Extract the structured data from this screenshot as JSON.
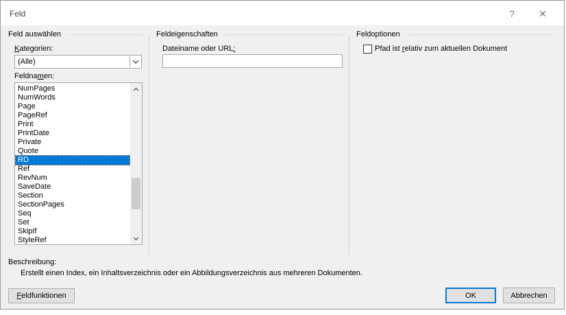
{
  "window": {
    "title": "Feld",
    "help_label": "?",
    "close_label": "✕"
  },
  "field_select": {
    "title": "Feld auswählen",
    "categories_label_first": "K",
    "categories_label_rest": "ategorien:",
    "categories_value": "(Alle)",
    "fieldnames_label_pre": "Feldna",
    "fieldnames_label_u": "m",
    "fieldnames_label_post": "en:",
    "items": [
      "NumPages",
      "NumWords",
      "Page",
      "PageRef",
      "Print",
      "PrintDate",
      "Private",
      "Quote",
      "RD",
      "Ref",
      "RevNum",
      "SaveDate",
      "Section",
      "SectionPages",
      "Seq",
      "Set",
      "SkipIf",
      "StyleRef"
    ],
    "selected": "RD"
  },
  "properties": {
    "title": "Feldeigenschaften",
    "filename_label_pre": "Dateiname oder URL",
    "filename_label_u": ":",
    "filename_value": ""
  },
  "options": {
    "title": "Feldoptionen",
    "checkbox_pre": "Pfad ist ",
    "checkbox_u": "r",
    "checkbox_post": "elativ zum aktuellen Dokument",
    "checked": false
  },
  "description": {
    "label": "Beschreibung:",
    "text": "Erstellt einen Index, ein Inhaltsverzeichnis oder ein Abbildungsverzeichnis aus mehreren Dokumenten."
  },
  "buttons": {
    "field_codes_u": "F",
    "field_codes_rest": "eldfunktionen",
    "ok": "OK",
    "cancel": "Abbrechen"
  },
  "colors": {
    "selection": "#0078d7",
    "default_button_border": "#0078d7"
  }
}
